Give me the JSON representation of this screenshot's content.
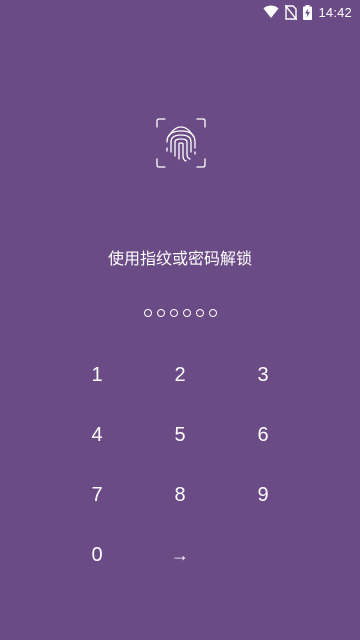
{
  "status_bar": {
    "time": "14:42",
    "icons": [
      "wifi-icon",
      "no-sim-icon",
      "battery-charging-icon"
    ]
  },
  "lock_screen": {
    "fingerprint_icon": "fingerprint-icon",
    "prompt": "使用指纹或密码解锁",
    "pin_length": 6,
    "pin_entered": 0
  },
  "keypad": {
    "keys": [
      "1",
      "2",
      "3",
      "4",
      "5",
      "6",
      "7",
      "8",
      "9",
      "0",
      "→"
    ]
  },
  "colors": {
    "background": "#6a4b85",
    "foreground": "#ffffff"
  }
}
